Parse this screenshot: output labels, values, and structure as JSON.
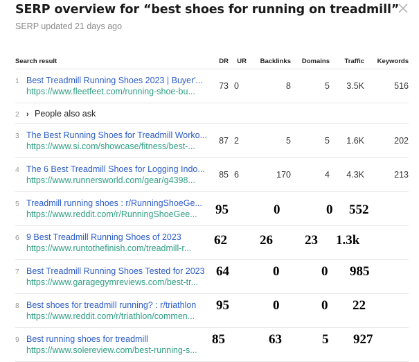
{
  "header": {
    "title": "SERP overview for “best shoes for running on treadmill”",
    "subtitle": "SERP updated 21 days ago",
    "close_icon": "close-icon"
  },
  "table": {
    "columns": [
      "Search result",
      "DR",
      "UR",
      "Backlinks",
      "Domains",
      "Traffic",
      "Keywords"
    ],
    "rows": [
      {
        "num": "1",
        "title": "Best Treadmill Running Shoes 2023 | Buyer'...",
        "url": "https://www.fleetfeet.com/running-shoe-bu...",
        "dr": "73",
        "ur": "0",
        "backlinks": "8",
        "domains": "5",
        "traffic": "3.5K",
        "keywords": "516"
      },
      {
        "num": "2",
        "paa": "People also ask",
        "arrow_icon": "chevron-right-icon"
      },
      {
        "num": "3",
        "title": "The Best Running Shoes for Treadmill Worko...",
        "url": "https://www.si.com/showcase/fitness/best-...",
        "dr": "87",
        "ur": "2",
        "backlinks": "5",
        "domains": "5",
        "traffic": "1.6K",
        "keywords": "202"
      },
      {
        "num": "4",
        "title": "The 6 Best Treadmill Shoes for Logging Indo...",
        "url": "https://www.runnersworld.com/gear/g4398...",
        "dr": "85",
        "ur": "6",
        "backlinks": "170",
        "domains": "4",
        "traffic": "4.3K",
        "keywords": "213"
      },
      {
        "num": "5",
        "title": "Treadmill running shoes : r/RunningShoeGe...",
        "url": "https://www.reddit.com/r/RunningShoeGee...",
        "v1": "95",
        "v2": "0",
        "v3": "0",
        "v4": "552"
      },
      {
        "num": "6",
        "title": "9 Best Treadmill Running Shoes of 2023",
        "url": "https://www.runtothefinish.com/treadmill-r...",
        "v1": "62",
        "v2": "26",
        "v3": "23",
        "v4": "1.3k"
      },
      {
        "num": "7",
        "title": "Best Treadmill Running Shoes Tested for 2023",
        "url": "https://www.garagegymreviews.com/best-tr...",
        "v1": "64",
        "v2": "0",
        "v3": "0",
        "v4": "985"
      },
      {
        "num": "8",
        "title": "Best shoes for treadmill running? : r/triathlon",
        "url": "https://www.reddit.com/r/triathlon/commen...",
        "v1": "95",
        "v2": "0",
        "v3": "0",
        "v4": "22"
      },
      {
        "num": "9",
        "title": "Best running shoes for treadmill",
        "url": "https://www.solereview.com/best-running-s...",
        "v1": "85",
        "v2": "63",
        "v3": "5",
        "v4": "927"
      }
    ]
  }
}
